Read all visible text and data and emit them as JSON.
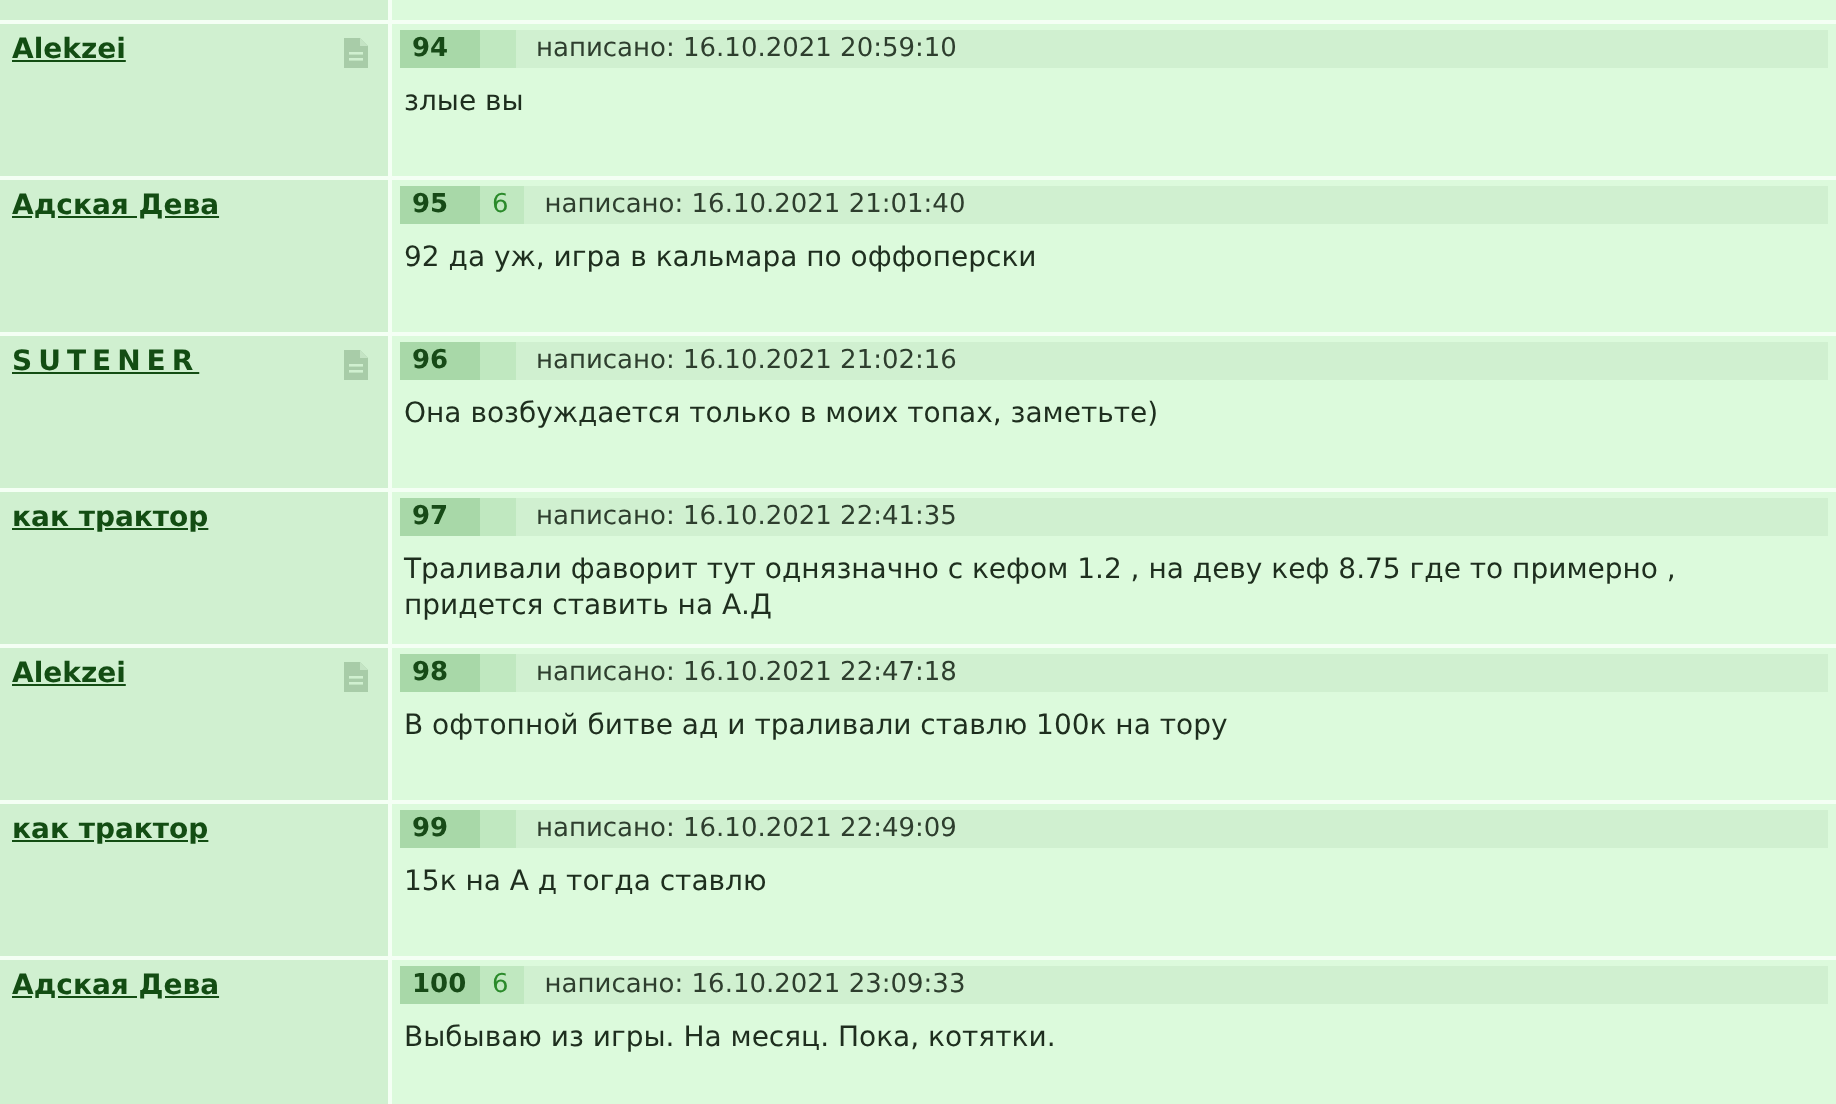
{
  "posts": [
    {
      "author": "Alekzei",
      "author_spaced": false,
      "doc_icon": true,
      "number": "94",
      "posted": "написано: 16.10.2021 20:59:10",
      "text": [
        "злые вы"
      ]
    },
    {
      "author": "Адская Дева",
      "author_spaced": false,
      "doc_icon": false,
      "number": "95",
      "rating": "6",
      "posted": "написано: 16.10.2021 21:01:40",
      "text": [
        "92 да уж, игра в кальмара по оффоперски"
      ]
    },
    {
      "author": "SUTENER",
      "author_spaced": true,
      "doc_icon": true,
      "number": "96",
      "posted": "написано: 16.10.2021 21:02:16",
      "text": [
        "Она возбуждается только в моих топах, заметьте)"
      ]
    },
    {
      "author": "как трактор",
      "author_spaced": false,
      "doc_icon": false,
      "number": "97",
      "posted": "написано: 16.10.2021 22:41:35",
      "text": [
        "Траливали фаворит тут однязначно с кефом 1.2 , на деву кеф 8.75 где то примерно ,",
        "придется ставить на А.Д"
      ]
    },
    {
      "author": "Alekzei",
      "author_spaced": false,
      "doc_icon": true,
      "number": "98",
      "posted": "написано: 16.10.2021 22:47:18",
      "text": [
        "В офтопной битве ад и траливали ставлю 100к на тору"
      ]
    },
    {
      "author": "как трактор",
      "author_spaced": false,
      "doc_icon": false,
      "number": "99",
      "posted": "написано: 16.10.2021 22:49:09",
      "text": [
        "15к на А д тогда ставлю"
      ]
    },
    {
      "author": "Адская Дева",
      "author_spaced": false,
      "doc_icon": false,
      "number": "100",
      "rating": "6",
      "posted": "написано: 16.10.2021 23:09:33",
      "text": [
        "Выбываю из игры. На месяц. Пока, котятки."
      ]
    }
  ]
}
